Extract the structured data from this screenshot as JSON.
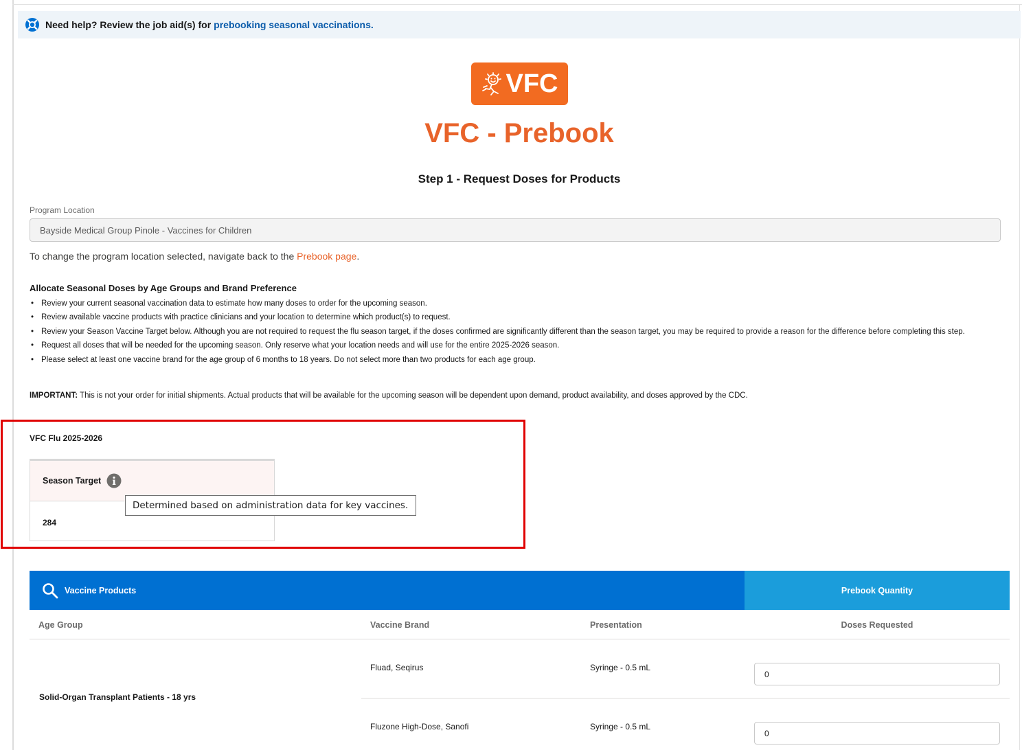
{
  "help": {
    "text": "Need help? Review the job aid(s) for",
    "link": "prebooking seasonal vaccinations."
  },
  "logo": {
    "text": "VFC"
  },
  "page": {
    "title": "VFC - Prebook",
    "step": "Step 1 - Request Doses for Products"
  },
  "location": {
    "label": "Program Location",
    "value": "Bayside Medical Group Pinole - Vaccines for Children",
    "note": "To change the program location selected, navigate back to the",
    "note_link": "Prebook page",
    "note_end": "."
  },
  "allocate": {
    "heading": "Allocate Seasonal Doses by Age Groups and Brand Preference",
    "bullets": [
      "Review your current seasonal vaccination data to estimate how many doses to order for the upcoming season.",
      "Review available vaccine products with practice clinicians and your location to determine which product(s) to request.",
      "Review your Season Vaccine Target below. Although you are not required to request the flu season target, if the doses confirmed are significantly different than the season target, you may be required to provide a reason for the difference before completing this step.",
      "Request all doses that will be needed for the upcoming season. Only reserve what your location needs and will use for the entire 2025-2026 season.",
      "Please select at least one vaccine brand for the age group of 6 months to 18 years. Do not select more than two products for each age group."
    ],
    "important_label": "IMPORTANT:",
    "important_text": " This is not your order for initial shipments. Actual products that will be available for the upcoming season will be dependent upon demand, product availability, and doses approved by the CDC."
  },
  "season": {
    "title": "VFC Flu 2025-2026",
    "target_label": "Season Target",
    "target_value": "284",
    "tooltip": "Determined based on administration data for key vaccines."
  },
  "products": {
    "header_label": "Vaccine Products",
    "qty_header_label": "Prebook Quantity",
    "columns": [
      "Age Group",
      "Vaccine Brand",
      "Presentation",
      "Doses Requested"
    ],
    "age_group": "Solid-Organ Transplant Patients - 18 yrs",
    "rows": [
      {
        "brand": "Fluad, Seqirus",
        "presentation": "Syringe - 0.5 mL",
        "doses": "0"
      },
      {
        "brand": "Fluzone High-Dose, Sanofi",
        "presentation": "Syringe - 0.5 mL",
        "doses": "0"
      }
    ]
  },
  "colors": {
    "brand_orange": "#f26b21",
    "title_orange": "#e8632a",
    "header_blue": "#0070d2",
    "qty_blue": "#1b9ddb",
    "highlight_red": "#e00000",
    "link_blue": "#0b5cab"
  },
  "icons": [
    "lifebuoy-icon",
    "vfc-mascot-icon",
    "info-icon",
    "search-icon"
  ]
}
